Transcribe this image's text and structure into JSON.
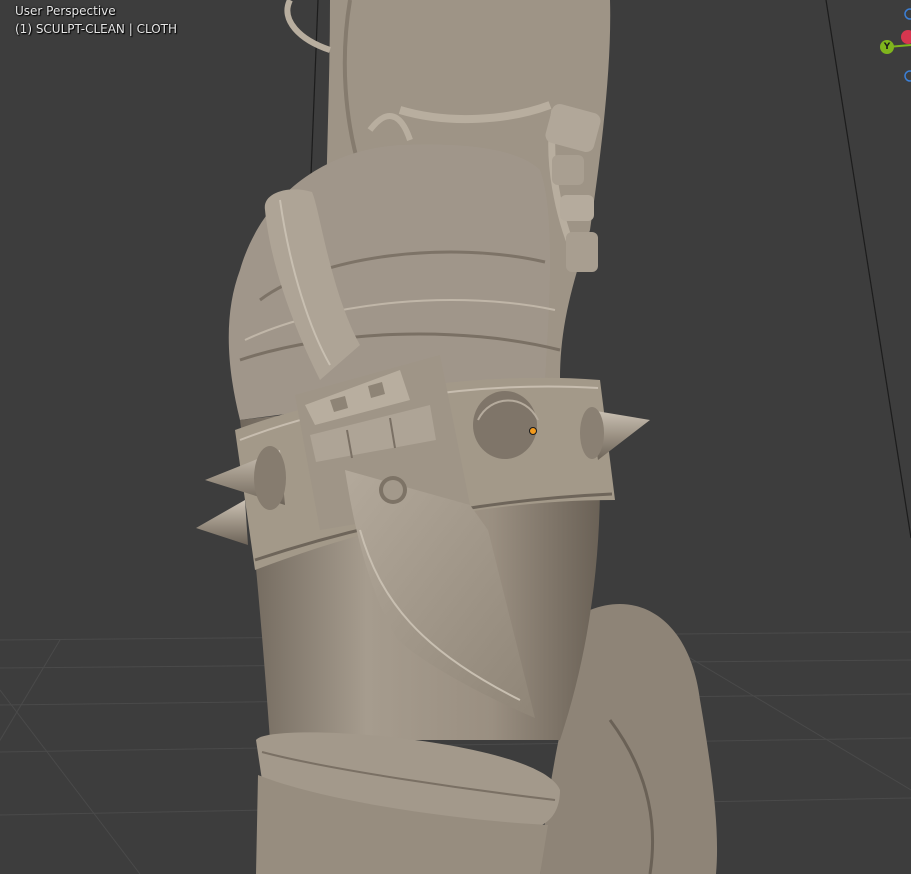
{
  "viewport": {
    "view_name": "User Perspective",
    "object_info": "(1) SCULPT-CLEAN | CLOTH"
  },
  "gizmo": {
    "y_label": "Y",
    "colors": {
      "x_axis": "#d6364f",
      "y_axis": "#7fb51d",
      "z_axis": "#3b7fd6"
    }
  },
  "theme": {
    "background": "#3d3d3d",
    "clay": "#a59a8c",
    "clay_shadow": "#6e655a",
    "clay_highlight": "#c2b8aa",
    "origin_dot": "#f29a1d"
  }
}
